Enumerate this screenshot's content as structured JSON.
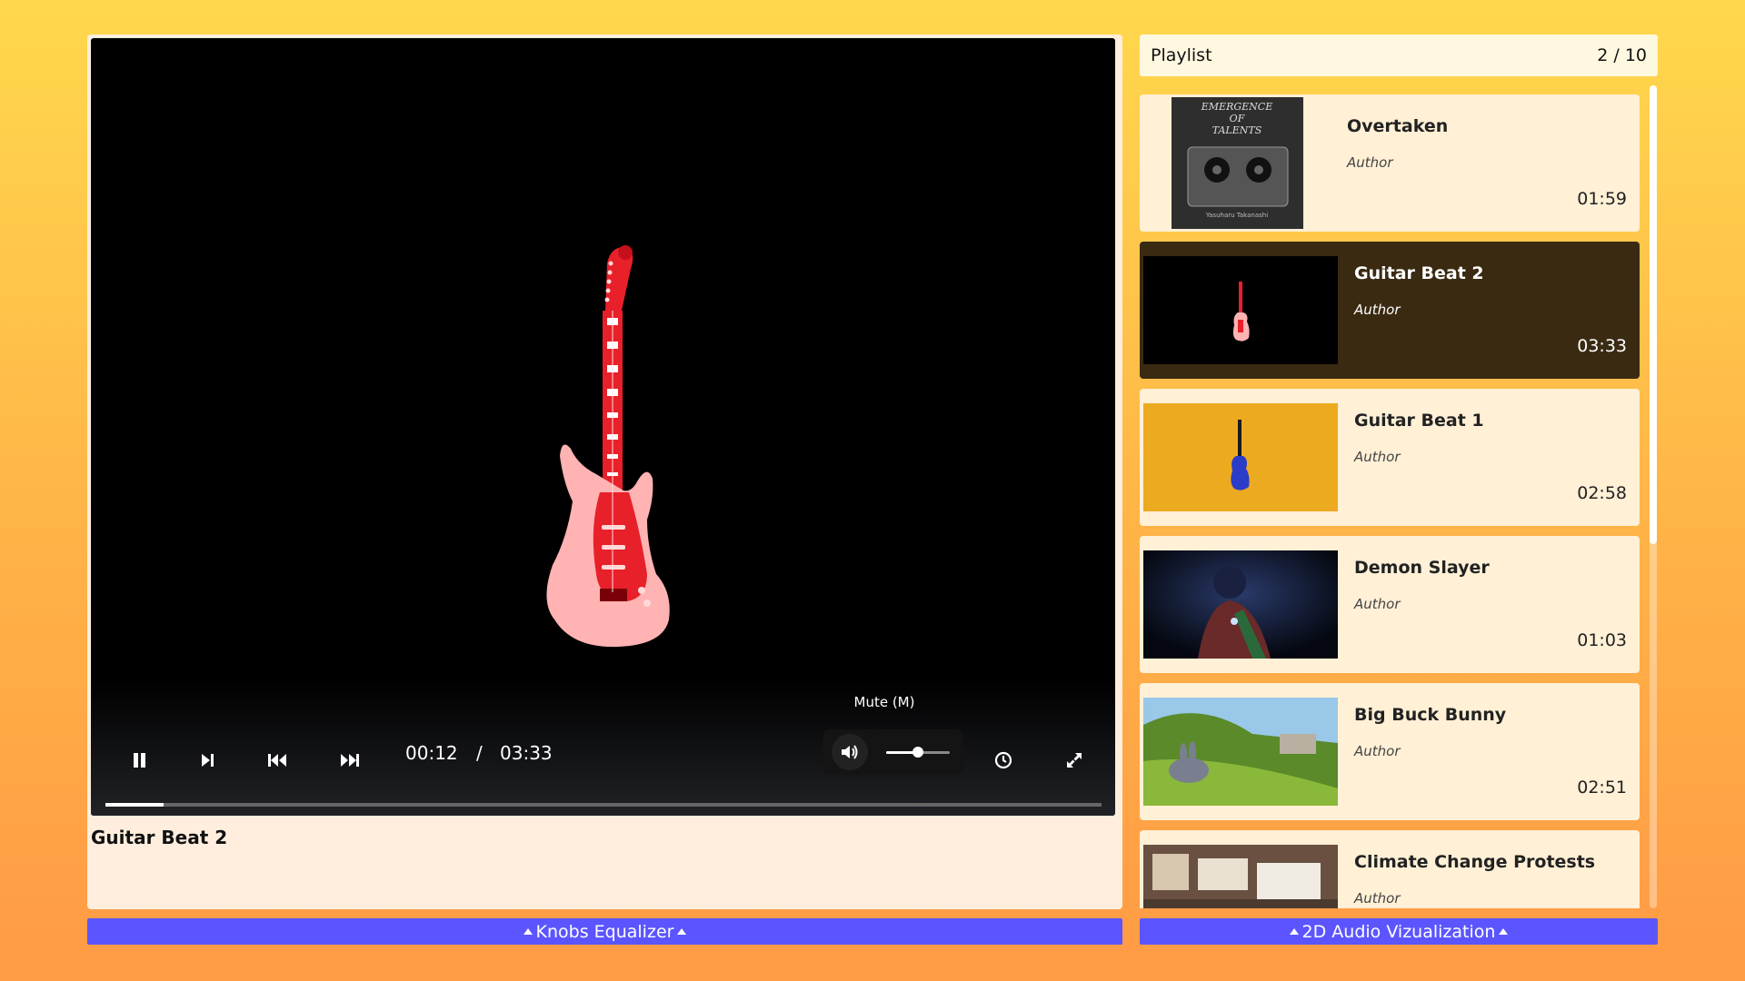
{
  "player": {
    "current_time": "00:12",
    "separator": "/",
    "duration": "03:33",
    "progress_fraction": 0.058,
    "volume_fraction": 0.5,
    "mute_tooltip": "Mute (M)",
    "now_playing_title": "Guitar Beat 2",
    "controls": [
      "pause-icon",
      "next-frame-icon",
      "previous-icon",
      "skip-next-icon",
      "volume-icon",
      "clock-icon",
      "fullscreen-icon"
    ]
  },
  "bottom_bars": {
    "equalizer_label": "Knobs Equalizer",
    "visualizer_label": "2D Audio Vizualization"
  },
  "playlist": {
    "title": "Playlist",
    "position": "2 / 10",
    "items": [
      {
        "title": "Overtaken",
        "author": "Author",
        "duration": "01:59",
        "active": false,
        "thumb_text": [
          "EMERGENCE",
          "OF",
          "TALENTS",
          "Yasuharu Takanashi"
        ]
      },
      {
        "title": "Guitar Beat 2",
        "author": "Author",
        "duration": "03:33",
        "active": true
      },
      {
        "title": "Guitar Beat 1",
        "author": "Author",
        "duration": "02:58",
        "active": false
      },
      {
        "title": "Demon Slayer",
        "author": "Author",
        "duration": "01:03",
        "active": false
      },
      {
        "title": "Big Buck Bunny",
        "author": "Author",
        "duration": "02:51",
        "active": false
      },
      {
        "title": "Climate Change Protests",
        "author": "Author",
        "duration": "",
        "active": false
      }
    ]
  },
  "colors": {
    "accent_bar": "#5c55ff",
    "active_item_bg": "#3a2a12",
    "guitar_body": "#ffb3b3",
    "guitar_neck": "#e8202a"
  }
}
